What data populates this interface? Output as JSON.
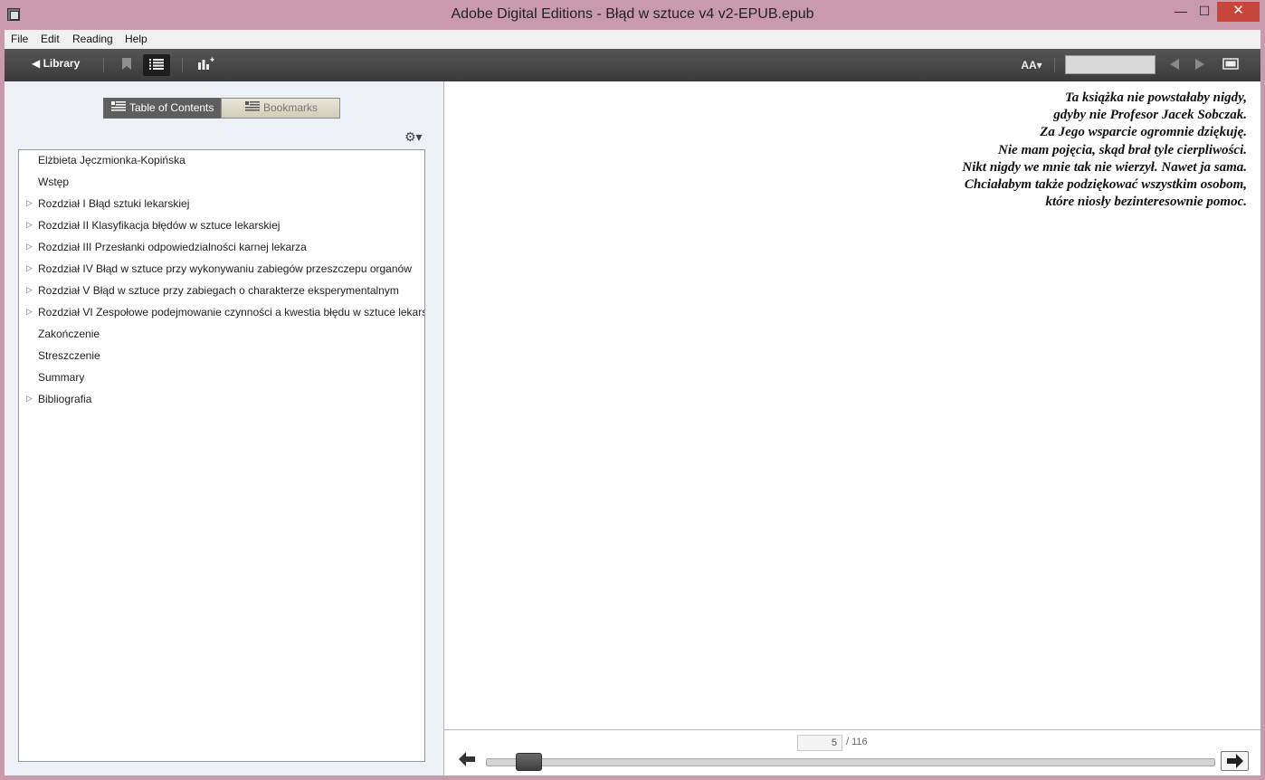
{
  "window": {
    "title": "Adobe Digital Editions - Błąd w sztuce v4 v2-EPUB.epub",
    "minimize": "—",
    "maximize": "☐",
    "close": "✕"
  },
  "menu": [
    "File",
    "Edit",
    "Reading",
    "Help"
  ],
  "toolbar": {
    "library_label": "◀ Library",
    "font_label": "AA▾"
  },
  "tabs": {
    "toc_label": "Table of Contents",
    "bookmarks_label": "Bookmarks"
  },
  "toc": [
    {
      "label": "Elżbieta Jęczmionka-Kopińska",
      "expandable": false
    },
    {
      "label": "Wstęp",
      "expandable": false
    },
    {
      "label": "Rozdział I Błąd sztuki lekarskiej",
      "expandable": true
    },
    {
      "label": "Rozdział II Klasyfikacja błędów w sztuce lekarskiej",
      "expandable": true
    },
    {
      "label": "Rozdział III Przesłanki odpowiedzialności karnej lekarza",
      "expandable": true
    },
    {
      "label": "Rozdział IV Błąd w sztuce przy wykonywaniu zabiegów przeszczepu organów",
      "expandable": true
    },
    {
      "label": "Rozdział V Błąd w sztuce przy zabiegach o charakterze eksperymentalnym",
      "expandable": true
    },
    {
      "label": "Rozdział VI Zespołowe podejmowanie czynności a kwestia błędu w sztuce lekarskiej",
      "expandable": true
    },
    {
      "label": "Zakończenie",
      "expandable": false
    },
    {
      "label": "Streszczenie",
      "expandable": false
    },
    {
      "label": "Summary",
      "expandable": false
    },
    {
      "label": "Bibliografia",
      "expandable": true
    }
  ],
  "content": {
    "lines": [
      "Ta książka nie powstałaby nigdy,",
      "gdyby nie Profesor Jacek Sobczak.",
      "Za Jego wsparcie ogromnie dziękuję.",
      "Nie mam pojęcia, skąd brał tyle cierpliwości.",
      "Nikt nigdy we mnie tak nie wierzył. Nawet ja sama.",
      "Chciałabym także podziękować wszystkim osobom,",
      "które niosły bezinteresownie pomoc."
    ]
  },
  "pager": {
    "current": "5",
    "total": "/ 116",
    "progress": 0.043
  },
  "icons": {
    "bookmark": "bookmark-icon",
    "list": "list-icon",
    "stats": "stats-icon",
    "fullscreen": "fullscreen-icon",
    "gear": "gear-icon"
  }
}
